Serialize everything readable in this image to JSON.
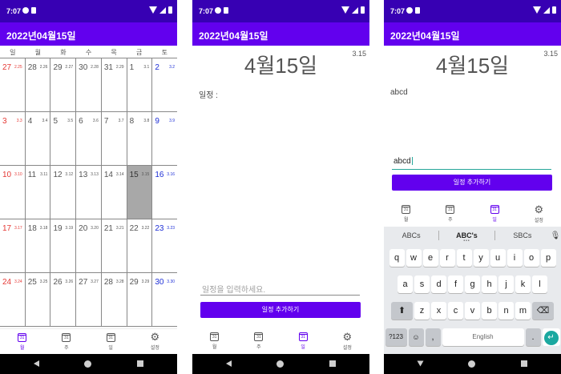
{
  "status": {
    "time": "7:07"
  },
  "app": {
    "title": "2022년04월15일"
  },
  "calendar": {
    "dow": [
      "일",
      "월",
      "화",
      "수",
      "목",
      "금",
      "토"
    ],
    "weeks": [
      [
        {
          "d": "27",
          "l": "2.25"
        },
        {
          "d": "28",
          "l": "2.26"
        },
        {
          "d": "29",
          "l": "2.27"
        },
        {
          "d": "30",
          "l": "2.28"
        },
        {
          "d": "31",
          "l": "2.29"
        },
        {
          "d": "1",
          "l": "3.1"
        },
        {
          "d": "2",
          "l": "3.2"
        }
      ],
      [
        {
          "d": "3",
          "l": "3.3"
        },
        {
          "d": "4",
          "l": "3.4"
        },
        {
          "d": "5",
          "l": "3.5"
        },
        {
          "d": "6",
          "l": "3.6"
        },
        {
          "d": "7",
          "l": "3.7"
        },
        {
          "d": "8",
          "l": "3.8"
        },
        {
          "d": "9",
          "l": "3.9"
        }
      ],
      [
        {
          "d": "10",
          "l": "3.10"
        },
        {
          "d": "11",
          "l": "3.11"
        },
        {
          "d": "12",
          "l": "3.12"
        },
        {
          "d": "13",
          "l": "3.13"
        },
        {
          "d": "14",
          "l": "3.14"
        },
        {
          "d": "15",
          "l": "3.15"
        },
        {
          "d": "16",
          "l": "3.16"
        }
      ],
      [
        {
          "d": "17",
          "l": "3.17"
        },
        {
          "d": "18",
          "l": "3.18"
        },
        {
          "d": "19",
          "l": "3.19"
        },
        {
          "d": "20",
          "l": "3.20"
        },
        {
          "d": "21",
          "l": "3.21"
        },
        {
          "d": "22",
          "l": "3.22"
        },
        {
          "d": "23",
          "l": "3.23"
        }
      ],
      [
        {
          "d": "24",
          "l": "3.24"
        },
        {
          "d": "25",
          "l": "3.25"
        },
        {
          "d": "26",
          "l": "3.26"
        },
        {
          "d": "27",
          "l": "3.27"
        },
        {
          "d": "28",
          "l": "3.28"
        },
        {
          "d": "29",
          "l": "3.29"
        },
        {
          "d": "30",
          "l": "3.30"
        }
      ]
    ],
    "selected_day": "15"
  },
  "nav": {
    "month": "월",
    "week": "주",
    "day": "일",
    "settings": "설정",
    "cal_icon_text": "31"
  },
  "dayview": {
    "title": "4월15일",
    "lunar": "3.15",
    "memo_label": "일정 :",
    "memo_text": "abcd",
    "input_placeholder": "일정을 입력하세요.",
    "input_value": "abcd",
    "add_button": "일정 추가하기"
  },
  "keyboard": {
    "suggestions": [
      "ABCs",
      "ABC's",
      "SBCs"
    ],
    "row1": [
      "q",
      "w",
      "e",
      "r",
      "t",
      "y",
      "u",
      "i",
      "o",
      "p"
    ],
    "row2": [
      "a",
      "s",
      "d",
      "f",
      "g",
      "h",
      "j",
      "k",
      "l"
    ],
    "row3": [
      "z",
      "x",
      "c",
      "v",
      "b",
      "n",
      "m"
    ],
    "sym": "?123",
    "emoji": "☺",
    "comma": ",",
    "space": "English",
    "period": "."
  },
  "colors": {
    "primary": "#6200ee",
    "status": "#3700b3",
    "sunday": "#e53935",
    "saturday": "#1e2fd6",
    "selected_cell": "#a8a8a8",
    "enter": "#1ba8a0"
  }
}
